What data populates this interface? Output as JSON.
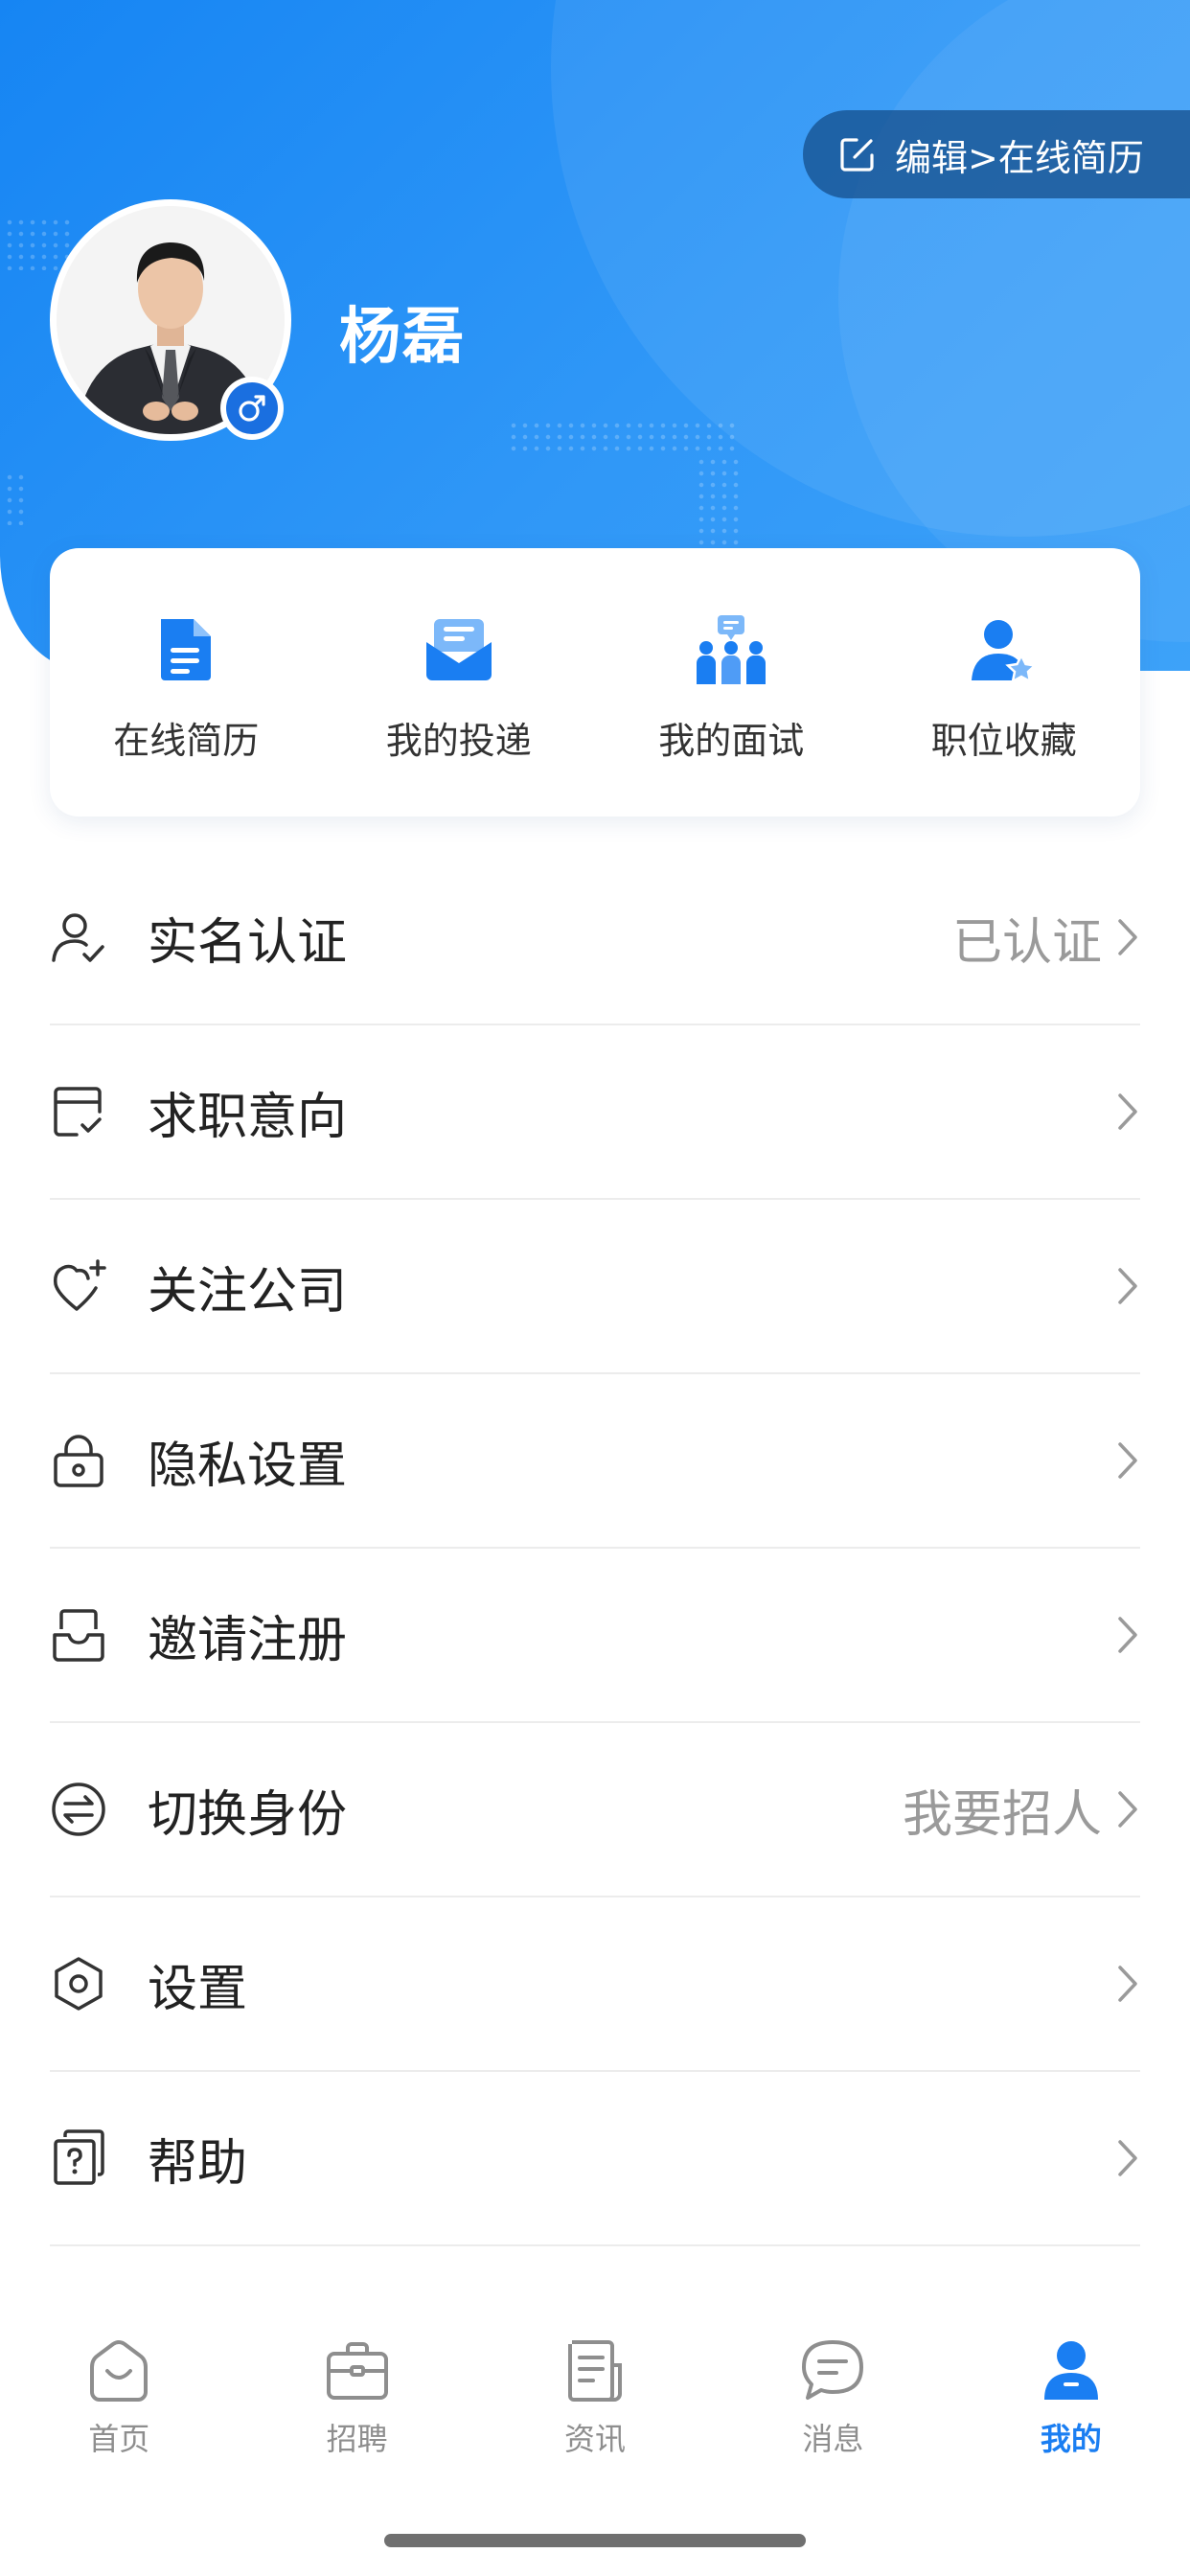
{
  "header": {
    "edit_button": "编辑>在线简历",
    "user_name": "杨磊",
    "gender": "male"
  },
  "quick_actions": [
    {
      "label": "在线简历",
      "icon": "resume-icon"
    },
    {
      "label": "我的投递",
      "icon": "envelope-icon"
    },
    {
      "label": "我的面试",
      "icon": "interview-icon"
    },
    {
      "label": "职位收藏",
      "icon": "favorite-user-icon"
    }
  ],
  "menu": [
    {
      "label": "实名认证",
      "value": "已认证",
      "icon": "user-check-icon"
    },
    {
      "label": "求职意向",
      "value": "",
      "icon": "calendar-check-icon"
    },
    {
      "label": "关注公司",
      "value": "",
      "icon": "heart-plus-icon"
    },
    {
      "label": "隐私设置",
      "value": "",
      "icon": "lock-icon"
    },
    {
      "label": "邀请注册",
      "value": "",
      "icon": "inbox-icon"
    },
    {
      "label": "切换身份",
      "value": "我要招人",
      "icon": "switch-icon"
    },
    {
      "label": "设置",
      "value": "",
      "icon": "gear-hex-icon"
    },
    {
      "label": "帮助",
      "value": "",
      "icon": "help-icon"
    }
  ],
  "tabs": [
    {
      "label": "首页",
      "icon": "home-icon",
      "active": false
    },
    {
      "label": "招聘",
      "icon": "briefcase-icon",
      "active": false
    },
    {
      "label": "资讯",
      "icon": "news-icon",
      "active": false
    },
    {
      "label": "消息",
      "icon": "chat-icon",
      "active": false
    },
    {
      "label": "我的",
      "icon": "profile-icon",
      "active": true
    }
  ],
  "colors": {
    "primary": "#1a7ef2",
    "header_gradient_start": "#1685f3",
    "header_gradient_end": "#3da2f9",
    "text_primary": "#222222",
    "text_secondary": "#9a9a9a",
    "tab_inactive": "#8e8e8e"
  }
}
